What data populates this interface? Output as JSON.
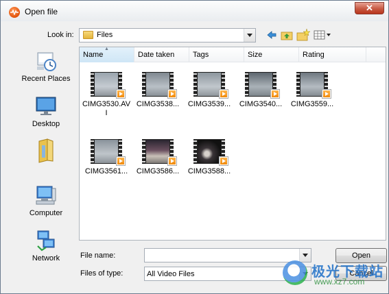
{
  "window": {
    "title": "Open file",
    "close_label": "✕"
  },
  "lookin": {
    "label": "Look in:",
    "value": "Files"
  },
  "places": [
    {
      "label": "Recent Places",
      "icon": "recent-places-icon"
    },
    {
      "label": "Desktop",
      "icon": "desktop-icon"
    },
    {
      "label": "",
      "icon": "user-folder-icon"
    },
    {
      "label": "Computer",
      "icon": "computer-icon"
    },
    {
      "label": "Network",
      "icon": "network-icon"
    }
  ],
  "columns": {
    "name": "Name",
    "date": "Date taken",
    "tags": "Tags",
    "size": "Size",
    "rating": "Rating"
  },
  "files": [
    {
      "label": "CIMG3530.AVI"
    },
    {
      "label": "CIMG3538..."
    },
    {
      "label": "CIMG3539..."
    },
    {
      "label": "CIMG3540..."
    },
    {
      "label": "CIMG3559..."
    },
    {
      "label": "CIMG3561..."
    },
    {
      "label": "CIMG3586..."
    },
    {
      "label": "CIMG3588..."
    }
  ],
  "filename": {
    "label": "File name:",
    "value": ""
  },
  "filetype": {
    "label": "Files of type:",
    "value": "All Video Files"
  },
  "buttons": {
    "open": "Open",
    "cancel": "Cancel"
  },
  "watermark": {
    "text": "极光下载站",
    "url": "www.xz7.com"
  }
}
